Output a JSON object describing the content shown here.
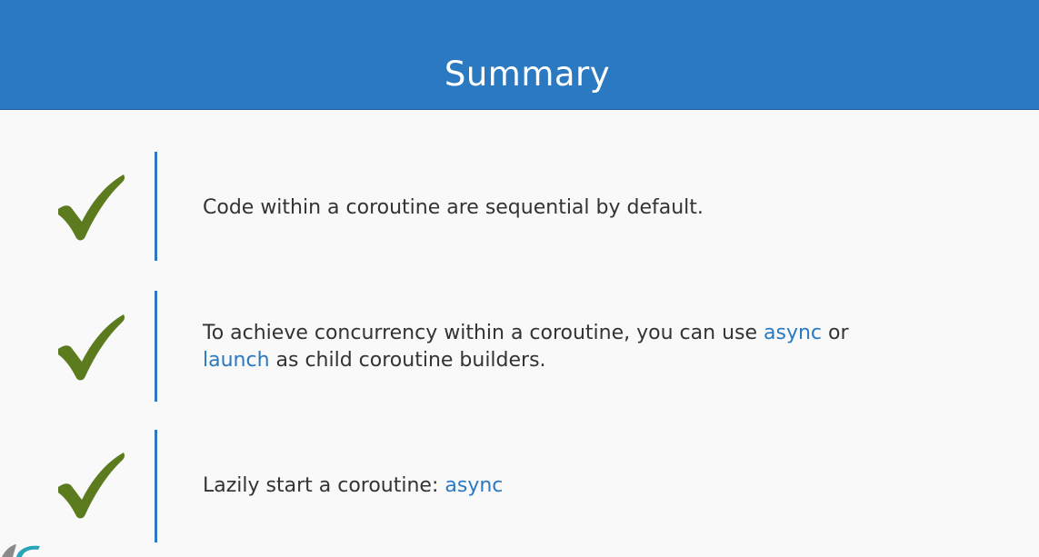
{
  "header": {
    "title": "Summary"
  },
  "colors": {
    "header_bg": "#2a79c1",
    "keyword": "#2a79c1",
    "check": "#5c7a1e",
    "text": "#333333"
  },
  "items": [
    {
      "icon": "check-icon",
      "text_a": "Code within a coroutine are sequential by default."
    },
    {
      "icon": "check-icon",
      "text_a": "To achieve concurrency within a coroutine, you can use ",
      "kw_a": "async",
      "text_b": " or",
      "kw_b": "launch",
      "text_c": " as child coroutine builders."
    },
    {
      "icon": "check-icon",
      "text_a": "Lazily start a coroutine: ",
      "kw_a": "async"
    }
  ]
}
